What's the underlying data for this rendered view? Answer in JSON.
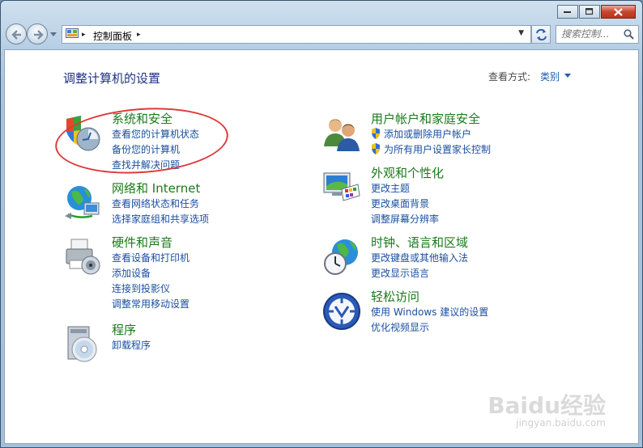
{
  "window": {
    "controls": [
      "minimize",
      "maximize",
      "close"
    ]
  },
  "address_bar": {
    "crumb": "控制面板",
    "separator": "▸",
    "dropdown": "▼"
  },
  "search": {
    "placeholder": "搜索控制..."
  },
  "page": {
    "title": "调整计算机的设置",
    "view_by_label": "查看方式:",
    "view_by_value": "类别"
  },
  "categories": [
    {
      "title": "系统和安全",
      "icon": "shield-icon",
      "links": [
        {
          "text": "查看您的计算机状态"
        },
        {
          "text": "备份您的计算机"
        },
        {
          "text": "查找并解决问题"
        }
      ]
    },
    {
      "title": "网络和 Internet",
      "icon": "network-globe-icon",
      "links": [
        {
          "text": "查看网络状态和任务"
        },
        {
          "text": "选择家庭组和共享选项"
        }
      ]
    },
    {
      "title": "硬件和声音",
      "icon": "printer-icon",
      "links": [
        {
          "text": "查看设备和打印机"
        },
        {
          "text": "添加设备"
        },
        {
          "text": "连接到投影仪"
        },
        {
          "text": "调整常用移动设置"
        }
      ]
    },
    {
      "title": "程序",
      "icon": "programs-disc-icon",
      "links": [
        {
          "text": "卸载程序"
        }
      ]
    },
    {
      "title": "用户帐户和家庭安全",
      "icon": "users-icon",
      "links": [
        {
          "text": "添加或删除用户帐户",
          "shield": true
        },
        {
          "text": "为所有用户设置家长控制",
          "shield": true
        }
      ]
    },
    {
      "title": "外观和个性化",
      "icon": "monitor-palette-icon",
      "links": [
        {
          "text": "更改主题"
        },
        {
          "text": "更改桌面背景"
        },
        {
          "text": "调整屏幕分辨率"
        }
      ]
    },
    {
      "title": "时钟、语言和区域",
      "icon": "clock-globe-icon",
      "links": [
        {
          "text": "更改键盘或其他输入法"
        },
        {
          "text": "更改显示语言"
        }
      ]
    },
    {
      "title": "轻松访问",
      "icon": "ease-of-access-icon",
      "links": [
        {
          "text": "使用 Windows 建议的设置"
        },
        {
          "text": "优化视频显示"
        }
      ]
    }
  ],
  "watermark": {
    "brand": "Baidu经验",
    "url": "jingyan.baidu.com"
  },
  "colors": {
    "category_title": "#1b7a1b",
    "link": "#1a4fa0",
    "page_title": "#1e3287",
    "annotation": "#e0393a"
  }
}
